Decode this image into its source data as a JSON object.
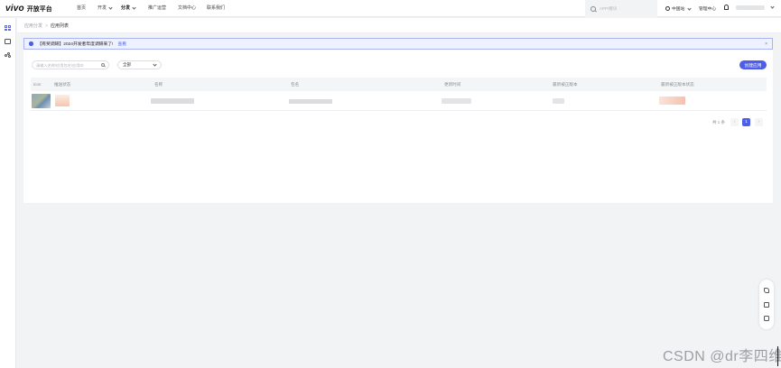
{
  "header": {
    "logo_text": "vivo",
    "brand_text": "开放平台",
    "nav": [
      {
        "label": "首页"
      },
      {
        "label": "开发"
      },
      {
        "label": "分发"
      },
      {
        "label": "推广运营"
      },
      {
        "label": "文档中心"
      },
      {
        "label": "联系我们"
      }
    ],
    "search_placeholder": "APP/模块",
    "region": "中国站",
    "manage": "管理中心"
  },
  "breadcrumb": {
    "parent": "应用分发",
    "separator": ">",
    "current": "应用列表"
  },
  "notice": {
    "text": "【有奖调研】2024开发者年度调研来了!",
    "link": "查看",
    "close": "×"
  },
  "filters": {
    "search_placeholder": "请输入名称/应用包名/应用ID",
    "select_value": "全部",
    "create_button": "创建应用"
  },
  "table": {
    "headers": [
      "icon",
      "推送状态",
      "名称",
      "包名",
      "更新时间",
      "最新被正版本",
      "最新被正版本状态"
    ]
  },
  "pagination": {
    "total_text": "共 1 条",
    "prev": "‹",
    "current_page": "1",
    "next": "›"
  },
  "watermark": "CSDN @dr李四维",
  "colors": {
    "accent": "#4d5ee8",
    "notice_bg": "#eef1ff",
    "page_bg": "#f2f3f5"
  }
}
